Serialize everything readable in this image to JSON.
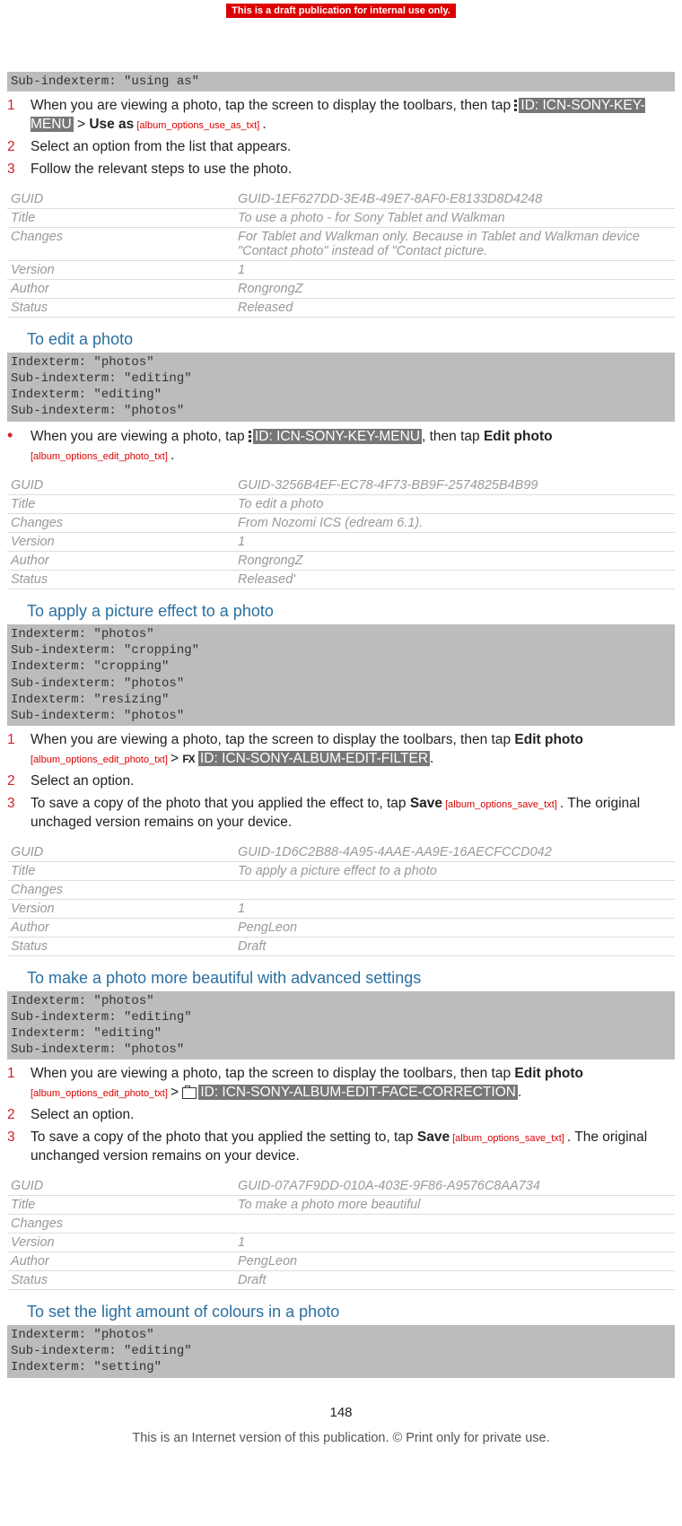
{
  "banner": "This is a draft publication for internal use only.",
  "top_index": "Sub-indexterm: \"using as\"",
  "sec0": {
    "step1a": "When you are viewing a photo, tap the screen to display the toolbars, then tap ",
    "id1": "ID: ICN-SONY-KEY-MENU",
    "gt": " > ",
    "useas": "Use as",
    "tag1": " [album_options_use_as_txt] ",
    "dot": ".",
    "step2": "Select an option from the list that appears.",
    "step3": "Follow the relevant steps to use the photo."
  },
  "meta0": {
    "guid_l": "GUID",
    "guid_v": "GUID-1EF627DD-3E4B-49E7-8AF0-E8133D8D4248",
    "title_l": "Title",
    "title_v": "To use a photo - for Sony Tablet and Walkman",
    "changes_l": "Changes",
    "changes_v": "For Tablet and Walkman only. Because in Tablet and Walkman device \"Contact photo\" instead of \"Contact picture.",
    "version_l": "Version",
    "version_v": "1",
    "author_l": "Author",
    "author_v": "RongrongZ",
    "status_l": "Status",
    "status_v": "Released"
  },
  "sec1_title": "To edit a photo",
  "sec1_index": "Indexterm: \"photos\"\nSub-indexterm: \"editing\"\nIndexterm: \"editing\"\nSub-indexterm: \"photos\"",
  "sec1": {
    "b1a": "When you are viewing a photo, tap ",
    "id": "ID: ICN-SONY-KEY-MENU",
    "b1b": ", then tap ",
    "editphoto": "Edit photo",
    "tag": " [album_options_edit_photo_txt] ",
    "dot": "."
  },
  "meta1": {
    "guid_v": "GUID-3256B4EF-EC78-4F73-BB9F-2574825B4B99",
    "title_v": "To edit a photo",
    "changes_v": "From Nozomi ICS (edream 6.1).",
    "version_v": "1",
    "author_v": "RongrongZ",
    "status_v": "Released'"
  },
  "sec2_title": "To apply a picture effect to a photo",
  "sec2_index": "Indexterm: \"photos\"\nSub-indexterm: \"cropping\"\nIndexterm: \"cropping\"\nSub-indexterm: \"photos\"\nIndexterm: \"resizing\"\nSub-indexterm: \"photos\"",
  "sec2": {
    "s1a": "When you are viewing a photo, tap the screen to display the toolbars, then tap ",
    "editphoto": "Edit photo",
    "tag_edit": " [album_options_edit_photo_txt] ",
    "gt": " > ",
    "fx": "FX",
    "id": "ID: ICN-SONY-ALBUM-EDIT-FILTER",
    "dot": ".",
    "s2": "Select an option.",
    "s3a": "To save a copy of the photo that you applied the effect to, tap ",
    "save": "Save",
    "tag_save": " [album_options_save_txt] ",
    "s3b": ". The original unchaged version remains on your device."
  },
  "meta2": {
    "guid_v": "GUID-1D6C2B88-4A95-4AAE-AA9E-16AECFCCD042",
    "title_v": "To apply a picture effect to a photo",
    "changes_v": "",
    "version_v": "1",
    "author_v": "PengLeon",
    "status_v": "Draft"
  },
  "sec3_title": "To make a photo more beautiful with advanced settings",
  "sec3_index": "Indexterm: \"photos\"\nSub-indexterm: \"editing\"\nIndexterm: \"editing\"\nSub-indexterm: \"photos\"",
  "sec3": {
    "s1a": "When you are viewing a photo, tap the screen to display the toolbars, then tap ",
    "editphoto": "Edit photo",
    "tag_edit": " [album_options_edit_photo_txt] ",
    "gt": " > ",
    "id": "ID: ICN-SONY-ALBUM-EDIT-FACE-CORRECTION",
    "dot": ".",
    "s2": "Select an option.",
    "s3a": "To save a copy of the photo that you applied the setting to, tap ",
    "save": "Save",
    "tag_save": " [album_options_save_txt] ",
    "s3b": ". The original unchanged version remains on your device."
  },
  "meta3": {
    "guid_v": "GUID-07A7F9DD-010A-403E-9F86-A9576C8AA734",
    "title_v": "To make a photo more beautiful",
    "changes_v": "",
    "version_v": "1",
    "author_v": "PengLeon",
    "status_v": "Draft"
  },
  "sec4_title": "To set the light amount of colours in a photo",
  "sec4_index": "Indexterm: \"photos\"\nSub-indexterm: \"editing\"\nIndexterm: \"setting\"",
  "page_number": "148",
  "footer": "This is an Internet version of this publication. © Print only for private use."
}
